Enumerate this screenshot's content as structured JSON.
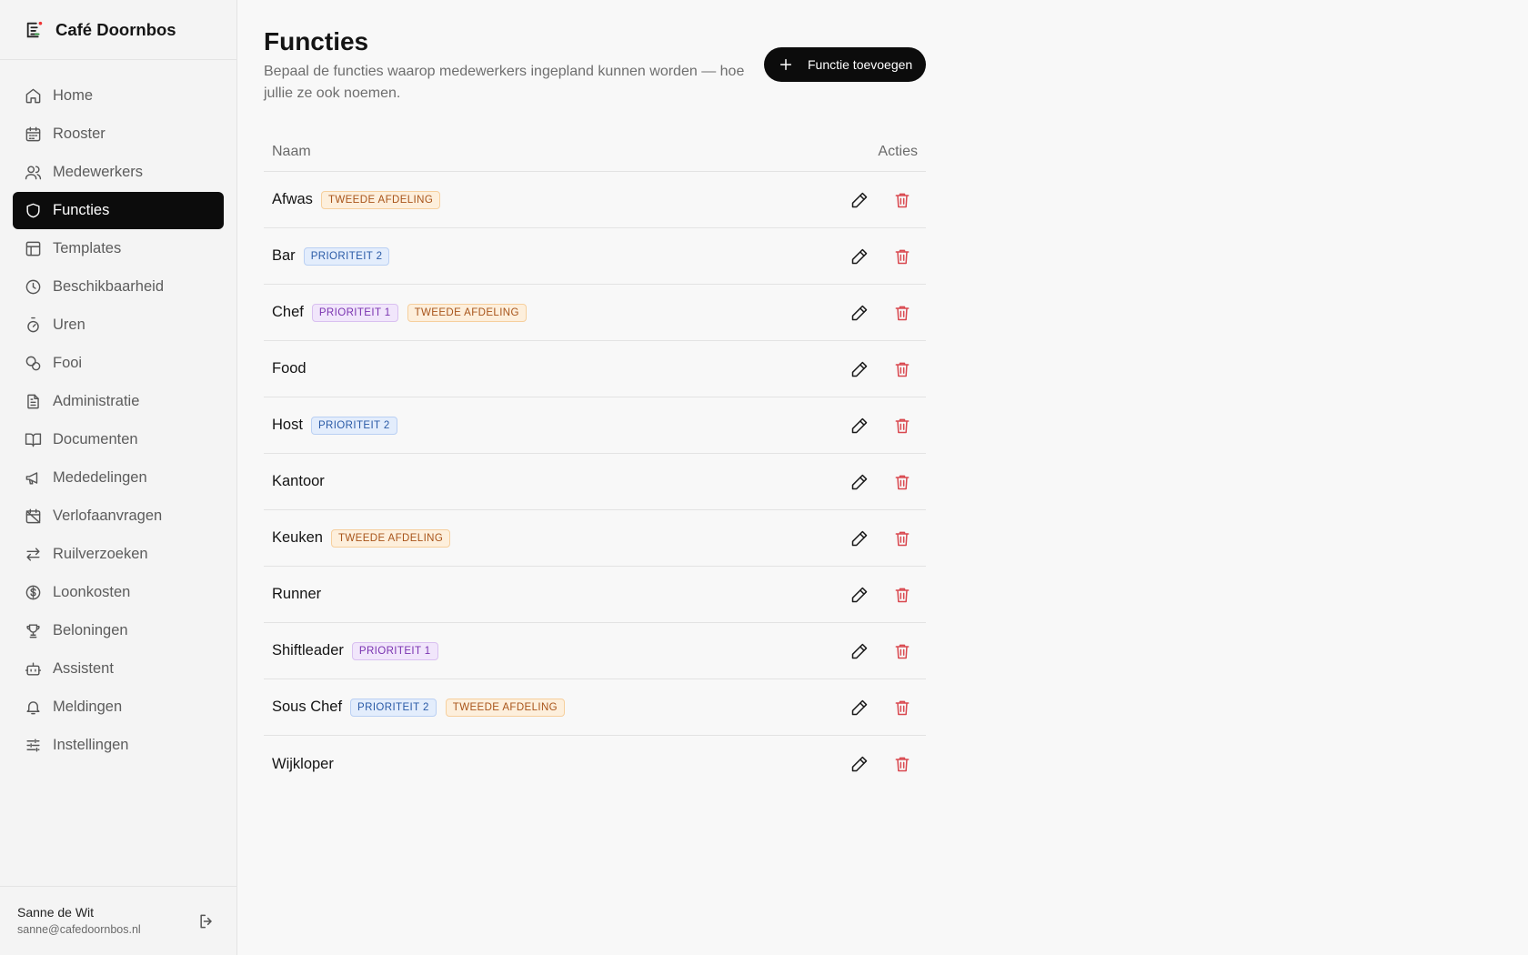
{
  "brand": {
    "name": "Café Doornbos",
    "logo_icon": "calendar-check-icon",
    "logo_accent": "#e33"
  },
  "nav": [
    {
      "label": "Home",
      "icon": "home-icon",
      "active": false
    },
    {
      "label": "Rooster",
      "icon": "calendar-icon",
      "active": false
    },
    {
      "label": "Medewerkers",
      "icon": "users-icon",
      "active": false
    },
    {
      "label": "Functies",
      "icon": "shield-icon",
      "active": true
    },
    {
      "label": "Templates",
      "icon": "layout-icon",
      "active": false
    },
    {
      "label": "Beschikbaarheid",
      "icon": "clock-icon",
      "active": false
    },
    {
      "label": "Uren",
      "icon": "timer-icon",
      "active": false
    },
    {
      "label": "Fooi",
      "icon": "coins-icon",
      "active": false
    },
    {
      "label": "Administratie",
      "icon": "file-text-icon",
      "active": false
    },
    {
      "label": "Documenten",
      "icon": "book-icon",
      "active": false
    },
    {
      "label": "Mededelingen",
      "icon": "megaphone-icon",
      "active": false
    },
    {
      "label": "Verlofaanvragen",
      "icon": "calendar-x-icon",
      "active": false
    },
    {
      "label": "Ruilverzoeken",
      "icon": "arrows-swap-icon",
      "active": false
    },
    {
      "label": "Loonkosten",
      "icon": "dollar-circle-icon",
      "active": false
    },
    {
      "label": "Beloningen",
      "icon": "trophy-icon",
      "active": false
    },
    {
      "label": "Assistent",
      "icon": "bot-icon",
      "active": false
    },
    {
      "label": "Meldingen",
      "icon": "bell-icon",
      "active": false
    },
    {
      "label": "Instellingen",
      "icon": "sliders-icon",
      "active": false
    }
  ],
  "user": {
    "name": "Sanne de Wit",
    "email": "sanne@cafedoornbos.nl"
  },
  "page": {
    "title": "Functies",
    "subtitle": "Bepaal de functies waarop medewerkers ingepland kunnen worden — hoe jullie ze ook noemen.",
    "add_button": "Functie toevoegen"
  },
  "table": {
    "col_name": "Naam",
    "col_actions": "Acties",
    "rows": [
      {
        "name": "Afwas",
        "badges": [
          {
            "text": "TWEEDE AFDELING",
            "color": "orange"
          }
        ]
      },
      {
        "name": "Bar",
        "badges": [
          {
            "text": "PRIORITEIT 2",
            "color": "blue"
          }
        ]
      },
      {
        "name": "Chef",
        "badges": [
          {
            "text": "PRIORITEIT 1",
            "color": "purple"
          },
          {
            "text": "TWEEDE AFDELING",
            "color": "orange"
          }
        ]
      },
      {
        "name": "Food",
        "badges": []
      },
      {
        "name": "Host",
        "badges": [
          {
            "text": "PRIORITEIT 2",
            "color": "blue"
          }
        ]
      },
      {
        "name": "Kantoor",
        "badges": []
      },
      {
        "name": "Keuken",
        "badges": [
          {
            "text": "TWEEDE AFDELING",
            "color": "orange"
          }
        ]
      },
      {
        "name": "Runner",
        "badges": []
      },
      {
        "name": "Shiftleader",
        "badges": [
          {
            "text": "PRIORITEIT 1",
            "color": "purple"
          }
        ]
      },
      {
        "name": "Sous Chef",
        "badges": [
          {
            "text": "PRIORITEIT 2",
            "color": "blue"
          },
          {
            "text": "TWEEDE AFDELING",
            "color": "orange"
          }
        ]
      },
      {
        "name": "Wijkloper",
        "badges": []
      }
    ]
  },
  "colors": {
    "active_nav": "#0c0c0c",
    "delete": "#d9484f",
    "badge_orange": "#a8541a",
    "badge_blue": "#2a5aa6",
    "badge_purple": "#7a33b0"
  }
}
